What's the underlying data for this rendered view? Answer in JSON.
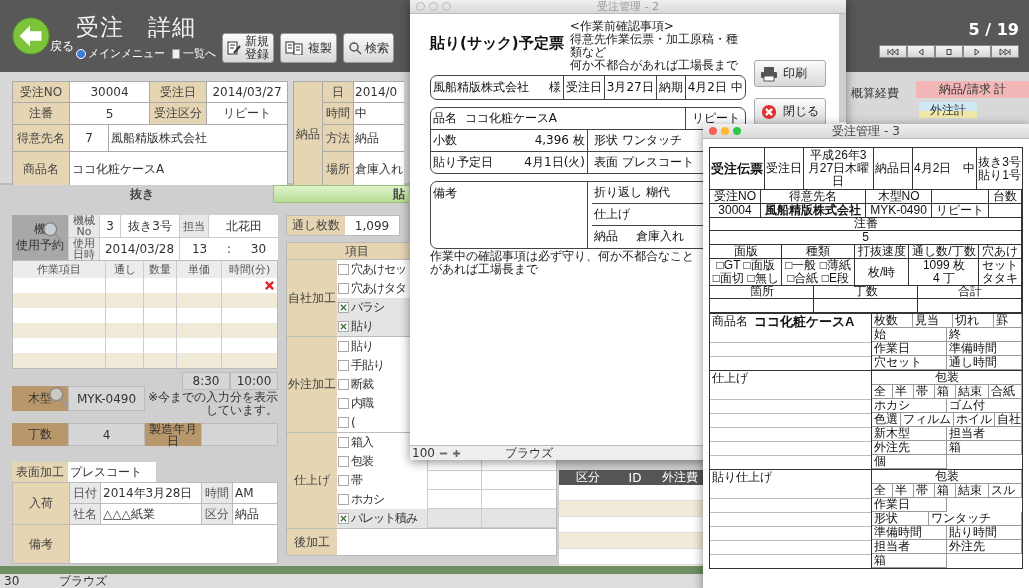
{
  "main": {
    "header": {
      "back_label": "戻る",
      "title": "受注　詳細",
      "links": [
        {
          "kind": "menu",
          "label": "メインメニュー"
        },
        {
          "kind": "list",
          "label": "一覧へ"
        }
      ],
      "buttons": [
        {
          "kind": "new",
          "label": "新規登録"
        },
        {
          "kind": "copy",
          "label": "複製"
        },
        {
          "kind": "search",
          "label": "検索"
        }
      ],
      "pager": "5 / 19"
    },
    "order": {
      "no": {
        "label": "受注NO",
        "value": "30004"
      },
      "date": {
        "label": "受注日",
        "value": "2014/03/27"
      },
      "chuban": {
        "label": "注番",
        "value": "5"
      },
      "kubun": {
        "label": "受注区分",
        "value": "リピート"
      },
      "customer": {
        "label": "得意先名",
        "code": "7",
        "name": "風船精版株式会社"
      },
      "product": {
        "label": "商品名",
        "value": "ココ化粧ケースA"
      }
    },
    "delivery": {
      "label": "納品",
      "rows": [
        {
          "label": "日",
          "value": "2014/0"
        },
        {
          "label": "時間",
          "value": "中"
        },
        {
          "label": "方法",
          "value": "納品"
        },
        {
          "label": "場所",
          "value": "倉庫入れ"
        }
      ]
    },
    "cost": {
      "label": "概算経費",
      "total_label": "納品/請求 計",
      "outsourced_label": "外注計"
    },
    "tabs": [
      {
        "label": "抜き",
        "selected": true
      },
      {
        "label": "貼",
        "selected": false
      }
    ],
    "machine": {
      "label_top": "機",
      "label_bottom": "使用予約",
      "no_label": "機械No",
      "no": "3",
      "name": "抜き3号",
      "staff_label": "担当",
      "staff": "北花田",
      "date_label": "使用日時",
      "date": "2014/03/28",
      "hour": "13",
      "sep": ":",
      "minute": "30"
    },
    "work_columns": [
      "作業項目",
      "通し",
      "数量",
      "単価",
      "時間(分)"
    ],
    "times": [
      "8:30",
      "10:00"
    ],
    "times_note": "※今までの入力分を表示しています。",
    "die": {
      "label": "木型",
      "value": "MYK-0490"
    },
    "count": {
      "label": "丁数",
      "value": "4"
    },
    "mfg_label": "製造年月日",
    "surface": {
      "label": "表面加工",
      "value": "プレスコート"
    },
    "arrival": {
      "label": "入荷",
      "date_label": "日付",
      "date": "2014年3月28日",
      "time_label": "時間",
      "time": "AM",
      "company_label": "社名",
      "company": "△△△紙業",
      "kind_label": "区分",
      "kind": "納品"
    },
    "remarks_label": "備考",
    "passes": {
      "label": "通し枚数",
      "value": "1,099"
    },
    "process": {
      "header": "項目",
      "groups": [
        {
          "label": "自社加工",
          "items": [
            {
              "label": "穴あけセッ",
              "checked": false
            },
            {
              "label": "穴あけタタ",
              "checked": false
            },
            {
              "label": "バラシ",
              "checked": true
            },
            {
              "label": "貼り",
              "checked": true
            }
          ]
        },
        {
          "label": "外注加工",
          "items": [
            {
              "label": "貼り",
              "checked": false
            },
            {
              "label": "手貼り",
              "checked": false
            },
            {
              "label": "断裁",
              "checked": false
            },
            {
              "label": "内職",
              "checked": false
            },
            {
              "label": "(",
              "checked": false
            }
          ]
        },
        {
          "label": "仕上げ",
          "items": [
            {
              "label": "箱入",
              "checked": false
            },
            {
              "label": "包装",
              "checked": false
            },
            {
              "label": "帯",
              "checked": false
            },
            {
              "label": "ホカシ",
              "checked": false
            },
            {
              "label": "パレット積み",
              "checked": true
            }
          ]
        },
        {
          "label": "後加工"
        }
      ]
    },
    "outsource_columns": [
      "区分",
      "ID",
      "外注費"
    ],
    "status": {
      "zoom": "30",
      "mode": "ブラウズ"
    }
  },
  "sheet": {
    "title": "受注管理 - 2",
    "heading": "貼り(サック)予定票",
    "notes": [
      "<作業前確認事項>",
      "得意先作業伝票・加工原稿・種類など",
      "何か不都合があれば工場長まで"
    ],
    "customer": "風船精版株式会社",
    "honorific": "様",
    "order_date_label": "受注日",
    "order_date": "3月27日",
    "due_label": "納期",
    "due": "4月2日",
    "due_time": "中",
    "product_label": "品名",
    "product": "ココ化粧ケースA",
    "repeat": "リピート",
    "qty_label": "小数",
    "qty": "4,396",
    "qty_unit": "枚",
    "shape_label": "形状",
    "shape": "ワンタッチ",
    "date_label": "貼り予定日",
    "date": "4月1日(火)",
    "surface_label": "表面",
    "surface": "プレスコート",
    "remarks_label": "備考",
    "fold_label": "折り返し",
    "fold": "糊代",
    "finish_label": "仕上げ",
    "delivery_label": "納品",
    "delivery": "倉庫入れ",
    "footer": "作業中の確認事項は必ず守り、何か不都合なことがあれば工場長まで",
    "buttons": [
      {
        "kind": "print",
        "label": "印刷"
      },
      {
        "kind": "close",
        "label": "閉じる"
      }
    ],
    "status": {
      "zoom": "100",
      "mode": "ブラウズ"
    }
  },
  "slip": {
    "title": "受注管理 - 3",
    "head": [
      {
        "kind": "title",
        "text": "受注伝票"
      },
      {
        "kind": "label",
        "text": "受注日"
      },
      {
        "kind": "value",
        "text": "平成26年3月27日木曜日"
      },
      {
        "kind": "label",
        "text": "納品日"
      },
      {
        "kind": "value",
        "text": "4月2日　中"
      },
      {
        "kind": "stack",
        "lines": [
          "抜き3号",
          "貼り1号"
        ]
      }
    ],
    "id_pairs": [
      {
        "label": "受注NO",
        "value": "30004"
      },
      {
        "label": "得意先名",
        "value": "風船精版株式会社"
      },
      {
        "label": "木型NO",
        "value": "MYK-0490"
      },
      {
        "value": "リピート"
      },
      {
        "label": "台数"
      },
      {
        "label": "注番",
        "value": "5"
      }
    ],
    "spec_pairs": [
      {
        "label": "面版",
        "lines": [
          "□GT □面版",
          "□面切 □無し"
        ]
      },
      {
        "label": "種類",
        "lines": [
          "□一般 □薄紙",
          "□合紙 □E段"
        ]
      },
      {
        "label": "打抜速度",
        "lines": [
          "枚/時"
        ]
      },
      {
        "label": "通し数/丁数",
        "lines": [
          "1099 枚",
          "4 丁"
        ]
      },
      {
        "label": "穴あけ",
        "lines": [
          "セット",
          "タタキ"
        ]
      },
      {
        "label": "箇所"
      },
      {
        "label": "丁数"
      },
      {
        "label": "合計"
      }
    ],
    "sections": [
      {
        "label": "商品名",
        "value": "ココ化粧ケースA",
        "side": [
          [
            "枚数",
            "見当",
            "切れ",
            "罫"
          ],
          [
            "始"
          ],
          [
            "終"
          ],
          [
            "作業日"
          ],
          [
            "準備時間"
          ],
          [
            "穴セット"
          ],
          [
            "通し時間"
          ]
        ]
      },
      {
        "label": "仕上げ",
        "side_title": "包装",
        "side": [
          [
            "全",
            "半",
            "帯",
            "箱",
            "結束",
            "合紙"
          ],
          [
            "ホカシ",
            "ゴム付"
          ],
          [
            "色選",
            "フィルム",
            "ホイル",
            "自社"
          ],
          [
            "新木型"
          ],
          [
            "担当者"
          ],
          [
            "外注先"
          ],
          [
            "箱"
          ],
          [
            "個"
          ]
        ]
      },
      {
        "label": "貼り仕上げ",
        "side_title": "包装",
        "side": [
          [
            "全",
            "半",
            "帯",
            "箱",
            "結束",
            "スル"
          ],
          [
            "作業日"
          ],
          [
            "形状",
            "ワンタッチ"
          ],
          [
            "準備時間"
          ],
          [
            "貼り時間"
          ],
          [
            "担当者"
          ],
          [
            "外注先"
          ],
          [
            "箱"
          ]
        ]
      }
    ]
  }
}
